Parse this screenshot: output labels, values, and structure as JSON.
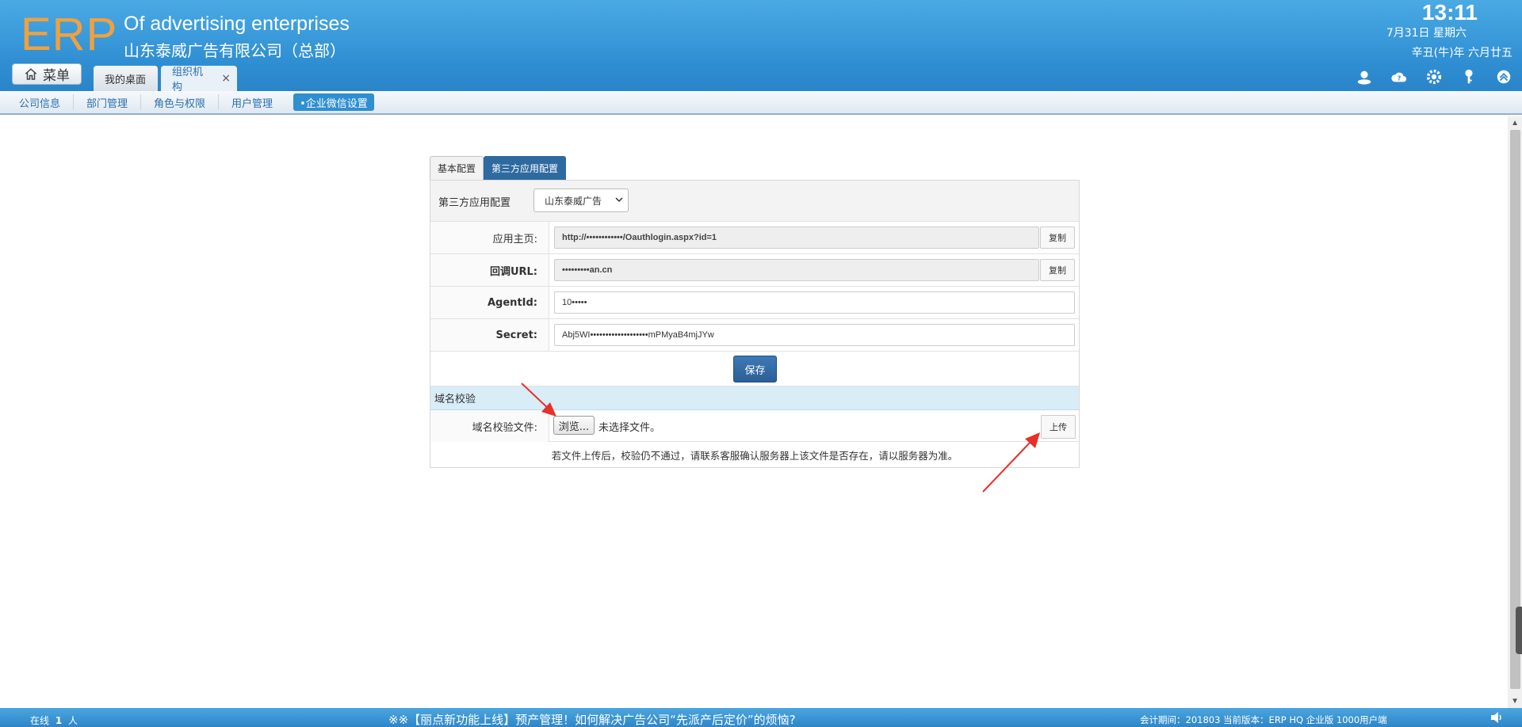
{
  "header": {
    "logo": "ERP",
    "brand_en": "Of advertising enterprises",
    "brand_cn": "山东泰威广告有限公司（总部）",
    "time": "13:11",
    "date": "7月31日 星期六",
    "lunar": "辛丑(牛)年 六月廿五",
    "menu_label": "菜单",
    "tabs": [
      {
        "label": "我的桌面"
      },
      {
        "label": "组织机构",
        "close": "×"
      }
    ]
  },
  "subnav": {
    "items": [
      {
        "label": "公司信息"
      },
      {
        "label": "部门管理"
      },
      {
        "label": "角色与权限"
      },
      {
        "label": "用户管理"
      },
      {
        "label": "•企业微信设置"
      }
    ]
  },
  "panel": {
    "tabs": [
      {
        "label": "基本配置"
      },
      {
        "label": "第三方应用配置"
      }
    ],
    "top_label": "第三方应用配置",
    "select_value": "山东泰威广告",
    "rows": [
      {
        "label": "应用主页:",
        "value": "http://••••••••••••/Oauthlogin.aspx?id=1",
        "button": "复制"
      },
      {
        "label": "回调URL:",
        "value": "•••••••••an.cn",
        "button": "复制"
      },
      {
        "label": "AgentId:",
        "value": "10•••••"
      },
      {
        "label": "Secret:",
        "value": "Abj5WI•••••••••••••••••••mPMyaB4mjJYw"
      }
    ],
    "save_label": "保存",
    "section_title": "域名校验",
    "file_label": "域名校验文件:",
    "browse_label": "浏览...",
    "no_file": "未选择文件。",
    "upload_label": "上传",
    "note": "若文件上传后，校验仍不通过，请联系客服确认服务器上该文件是否存在，请以服务器为准。"
  },
  "footer": {
    "online_prefix": "在线",
    "online_count": "1",
    "online_suffix": "人",
    "news": "※※【丽点新功能上线】预产管理！如何解决广告公司“先派产后定价”的烦恼?",
    "version": "会计期间：201803 当前版本：ERP HQ 企业版 1000用户端"
  },
  "colors": {
    "header_blue": "#2f8ed2",
    "logo_orange": "#f0a040",
    "save_blue": "#2e6aa0",
    "section_bg": "#d9edf7",
    "arrow_red": "#e8302a"
  }
}
